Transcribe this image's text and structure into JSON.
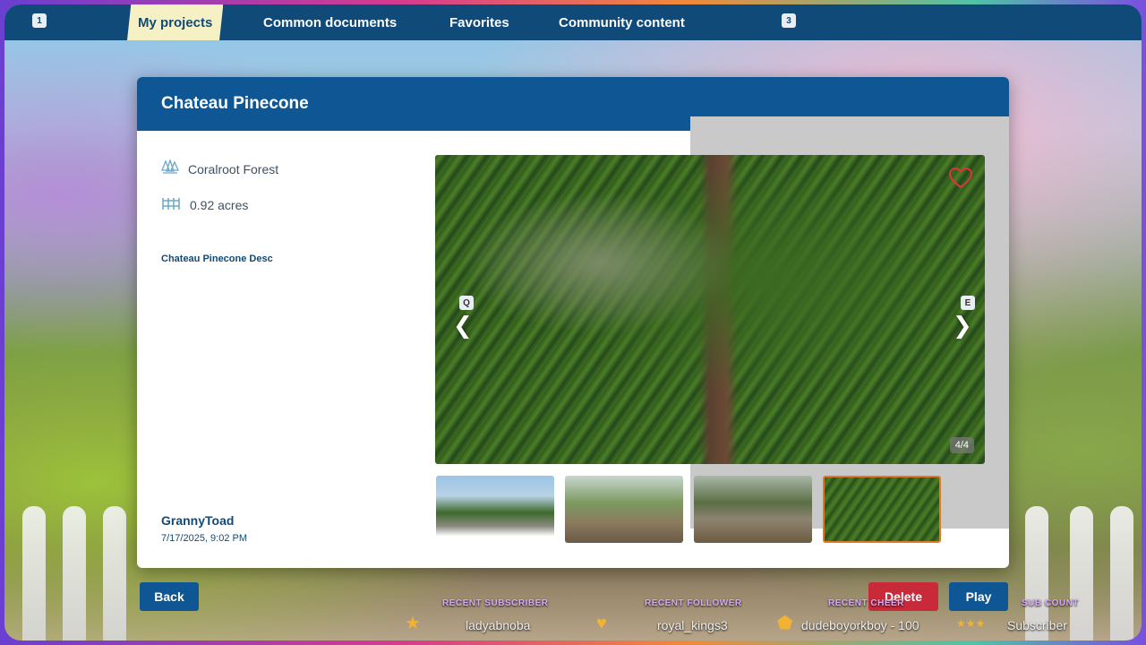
{
  "nav": {
    "left_key": "1",
    "right_key": "3",
    "tabs": [
      {
        "label": "My projects",
        "active": true
      },
      {
        "label": "Common documents",
        "active": false
      },
      {
        "label": "Favorites",
        "active": false
      },
      {
        "label": "Community content",
        "active": false
      }
    ]
  },
  "project": {
    "title": "Chateau Pinecone",
    "location": "Coralroot Forest",
    "size": "0.92 acres",
    "description": "Chateau Pinecone Desc",
    "author": "GrannyToad",
    "date": "7/17/2025, 9:02 PM"
  },
  "gallery": {
    "prev_key": "Q",
    "next_key": "E",
    "prev_arrow": "❮",
    "next_arrow": "❯",
    "counter": "4/4",
    "selected_index": 4
  },
  "actions": {
    "back": "Back",
    "delete": "Delete",
    "play": "Play"
  },
  "stream_overlay": {
    "recent_subscriber_label": "RECENT SUBSCRIBER",
    "recent_subscriber": "ladyabnoba",
    "recent_follower_label": "RECENT FOLLOWER",
    "recent_follower": "royal_kings3",
    "recent_cheer_label": "RECENT CHEER",
    "recent_cheer": "dudeboyorkboy - 100",
    "sub_count_label": "SUB COUNT",
    "sub_count": "Subscriber"
  },
  "colors": {
    "primary": "#0f5794",
    "nav_bg": "#0f4a78",
    "active_tab": "#f6f1c4",
    "delete": "#c92a3a",
    "thumb_selected": "#e07a26",
    "favorite_heart": "#e0343c"
  }
}
